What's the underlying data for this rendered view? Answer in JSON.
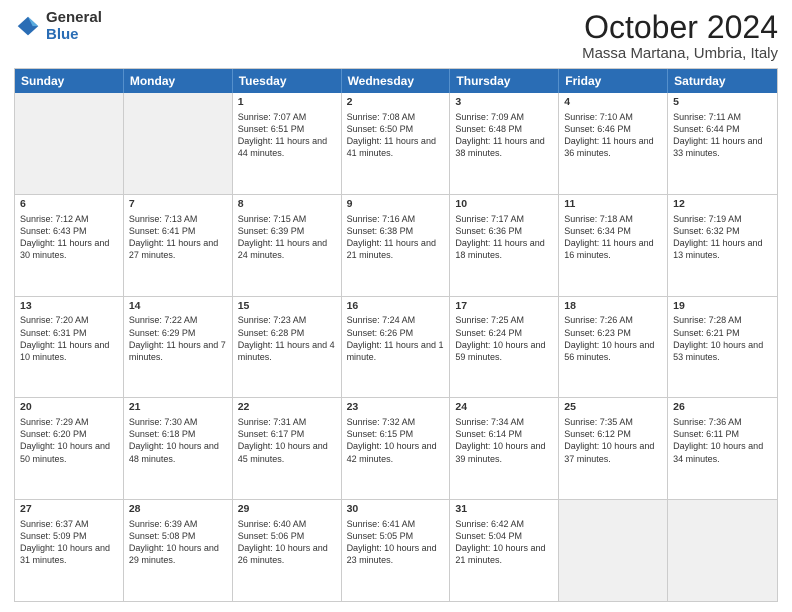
{
  "logo": {
    "general": "General",
    "blue": "Blue"
  },
  "title": {
    "month": "October 2024",
    "location": "Massa Martana, Umbria, Italy"
  },
  "header_days": [
    "Sunday",
    "Monday",
    "Tuesday",
    "Wednesday",
    "Thursday",
    "Friday",
    "Saturday"
  ],
  "rows": [
    [
      {
        "day": "",
        "sunrise": "",
        "sunset": "",
        "daylight": "",
        "empty": true
      },
      {
        "day": "",
        "sunrise": "",
        "sunset": "",
        "daylight": "",
        "empty": true
      },
      {
        "day": "1",
        "sunrise": "Sunrise: 7:07 AM",
        "sunset": "Sunset: 6:51 PM",
        "daylight": "Daylight: 11 hours and 44 minutes.",
        "empty": false
      },
      {
        "day": "2",
        "sunrise": "Sunrise: 7:08 AM",
        "sunset": "Sunset: 6:50 PM",
        "daylight": "Daylight: 11 hours and 41 minutes.",
        "empty": false
      },
      {
        "day": "3",
        "sunrise": "Sunrise: 7:09 AM",
        "sunset": "Sunset: 6:48 PM",
        "daylight": "Daylight: 11 hours and 38 minutes.",
        "empty": false
      },
      {
        "day": "4",
        "sunrise": "Sunrise: 7:10 AM",
        "sunset": "Sunset: 6:46 PM",
        "daylight": "Daylight: 11 hours and 36 minutes.",
        "empty": false
      },
      {
        "day": "5",
        "sunrise": "Sunrise: 7:11 AM",
        "sunset": "Sunset: 6:44 PM",
        "daylight": "Daylight: 11 hours and 33 minutes.",
        "empty": false
      }
    ],
    [
      {
        "day": "6",
        "sunrise": "Sunrise: 7:12 AM",
        "sunset": "Sunset: 6:43 PM",
        "daylight": "Daylight: 11 hours and 30 minutes.",
        "empty": false
      },
      {
        "day": "7",
        "sunrise": "Sunrise: 7:13 AM",
        "sunset": "Sunset: 6:41 PM",
        "daylight": "Daylight: 11 hours and 27 minutes.",
        "empty": false
      },
      {
        "day": "8",
        "sunrise": "Sunrise: 7:15 AM",
        "sunset": "Sunset: 6:39 PM",
        "daylight": "Daylight: 11 hours and 24 minutes.",
        "empty": false
      },
      {
        "day": "9",
        "sunrise": "Sunrise: 7:16 AM",
        "sunset": "Sunset: 6:38 PM",
        "daylight": "Daylight: 11 hours and 21 minutes.",
        "empty": false
      },
      {
        "day": "10",
        "sunrise": "Sunrise: 7:17 AM",
        "sunset": "Sunset: 6:36 PM",
        "daylight": "Daylight: 11 hours and 18 minutes.",
        "empty": false
      },
      {
        "day": "11",
        "sunrise": "Sunrise: 7:18 AM",
        "sunset": "Sunset: 6:34 PM",
        "daylight": "Daylight: 11 hours and 16 minutes.",
        "empty": false
      },
      {
        "day": "12",
        "sunrise": "Sunrise: 7:19 AM",
        "sunset": "Sunset: 6:32 PM",
        "daylight": "Daylight: 11 hours and 13 minutes.",
        "empty": false
      }
    ],
    [
      {
        "day": "13",
        "sunrise": "Sunrise: 7:20 AM",
        "sunset": "Sunset: 6:31 PM",
        "daylight": "Daylight: 11 hours and 10 minutes.",
        "empty": false
      },
      {
        "day": "14",
        "sunrise": "Sunrise: 7:22 AM",
        "sunset": "Sunset: 6:29 PM",
        "daylight": "Daylight: 11 hours and 7 minutes.",
        "empty": false
      },
      {
        "day": "15",
        "sunrise": "Sunrise: 7:23 AM",
        "sunset": "Sunset: 6:28 PM",
        "daylight": "Daylight: 11 hours and 4 minutes.",
        "empty": false
      },
      {
        "day": "16",
        "sunrise": "Sunrise: 7:24 AM",
        "sunset": "Sunset: 6:26 PM",
        "daylight": "Daylight: 11 hours and 1 minute.",
        "empty": false
      },
      {
        "day": "17",
        "sunrise": "Sunrise: 7:25 AM",
        "sunset": "Sunset: 6:24 PM",
        "daylight": "Daylight: 10 hours and 59 minutes.",
        "empty": false
      },
      {
        "day": "18",
        "sunrise": "Sunrise: 7:26 AM",
        "sunset": "Sunset: 6:23 PM",
        "daylight": "Daylight: 10 hours and 56 minutes.",
        "empty": false
      },
      {
        "day": "19",
        "sunrise": "Sunrise: 7:28 AM",
        "sunset": "Sunset: 6:21 PM",
        "daylight": "Daylight: 10 hours and 53 minutes.",
        "empty": false
      }
    ],
    [
      {
        "day": "20",
        "sunrise": "Sunrise: 7:29 AM",
        "sunset": "Sunset: 6:20 PM",
        "daylight": "Daylight: 10 hours and 50 minutes.",
        "empty": false
      },
      {
        "day": "21",
        "sunrise": "Sunrise: 7:30 AM",
        "sunset": "Sunset: 6:18 PM",
        "daylight": "Daylight: 10 hours and 48 minutes.",
        "empty": false
      },
      {
        "day": "22",
        "sunrise": "Sunrise: 7:31 AM",
        "sunset": "Sunset: 6:17 PM",
        "daylight": "Daylight: 10 hours and 45 minutes.",
        "empty": false
      },
      {
        "day": "23",
        "sunrise": "Sunrise: 7:32 AM",
        "sunset": "Sunset: 6:15 PM",
        "daylight": "Daylight: 10 hours and 42 minutes.",
        "empty": false
      },
      {
        "day": "24",
        "sunrise": "Sunrise: 7:34 AM",
        "sunset": "Sunset: 6:14 PM",
        "daylight": "Daylight: 10 hours and 39 minutes.",
        "empty": false
      },
      {
        "day": "25",
        "sunrise": "Sunrise: 7:35 AM",
        "sunset": "Sunset: 6:12 PM",
        "daylight": "Daylight: 10 hours and 37 minutes.",
        "empty": false
      },
      {
        "day": "26",
        "sunrise": "Sunrise: 7:36 AM",
        "sunset": "Sunset: 6:11 PM",
        "daylight": "Daylight: 10 hours and 34 minutes.",
        "empty": false
      }
    ],
    [
      {
        "day": "27",
        "sunrise": "Sunrise: 6:37 AM",
        "sunset": "Sunset: 5:09 PM",
        "daylight": "Daylight: 10 hours and 31 minutes.",
        "empty": false
      },
      {
        "day": "28",
        "sunrise": "Sunrise: 6:39 AM",
        "sunset": "Sunset: 5:08 PM",
        "daylight": "Daylight: 10 hours and 29 minutes.",
        "empty": false
      },
      {
        "day": "29",
        "sunrise": "Sunrise: 6:40 AM",
        "sunset": "Sunset: 5:06 PM",
        "daylight": "Daylight: 10 hours and 26 minutes.",
        "empty": false
      },
      {
        "day": "30",
        "sunrise": "Sunrise: 6:41 AM",
        "sunset": "Sunset: 5:05 PM",
        "daylight": "Daylight: 10 hours and 23 minutes.",
        "empty": false
      },
      {
        "day": "31",
        "sunrise": "Sunrise: 6:42 AM",
        "sunset": "Sunset: 5:04 PM",
        "daylight": "Daylight: 10 hours and 21 minutes.",
        "empty": false
      },
      {
        "day": "",
        "sunrise": "",
        "sunset": "",
        "daylight": "",
        "empty": true
      },
      {
        "day": "",
        "sunrise": "",
        "sunset": "",
        "daylight": "",
        "empty": true
      }
    ]
  ]
}
